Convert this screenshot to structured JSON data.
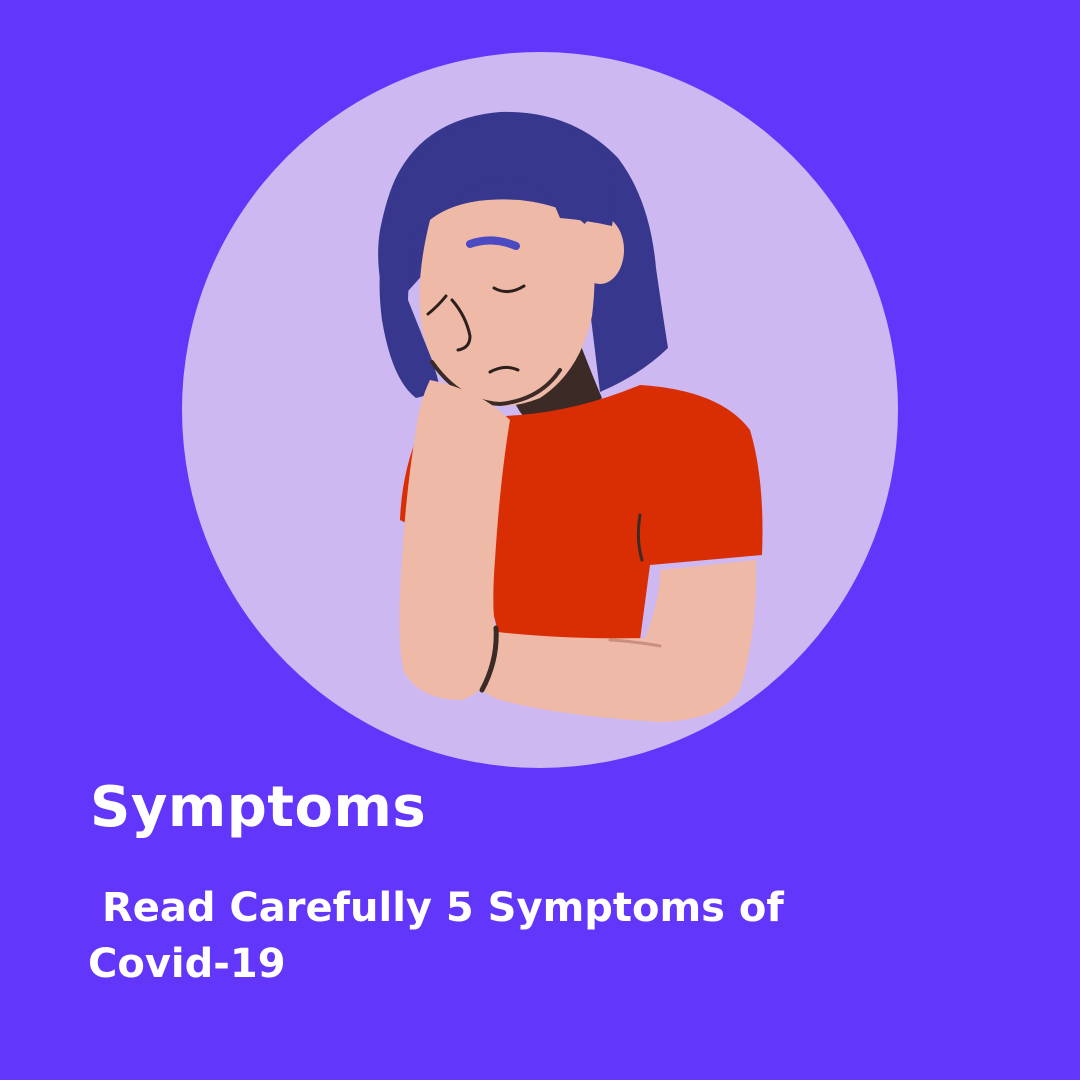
{
  "colors": {
    "background": "#6336fb",
    "circle": "#cdb8f1",
    "hair": "#36378d",
    "skin": "#efb9a8",
    "shirt": "#d92d04",
    "outline": "#3b2a25",
    "text": "#ffffff"
  },
  "illustration": {
    "icon": "tired-woman-resting-head-on-hand-illustration"
  },
  "title": "Symptoms",
  "subtitle": " Read Carefully 5 Symptoms of\nCovid-19"
}
